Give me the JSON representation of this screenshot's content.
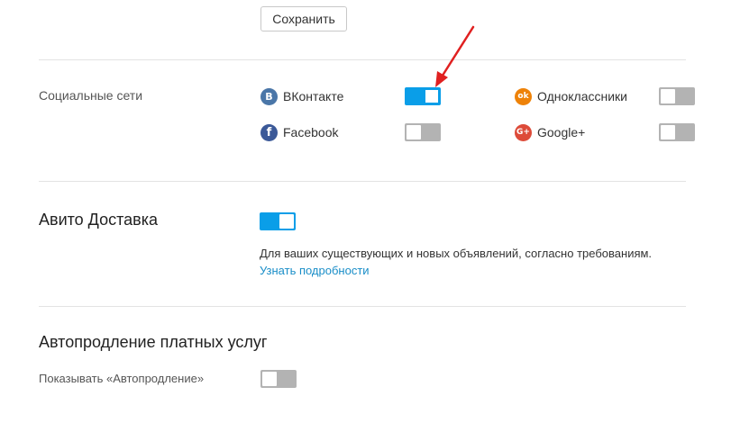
{
  "save": {
    "label": "Сохранить"
  },
  "social": {
    "section_label": "Социальные сети",
    "items": [
      {
        "name": "ВКонтакте",
        "icon": "vk-icon",
        "icon_glyph": "B",
        "color": "#4a76a8",
        "enabled": true
      },
      {
        "name": "Одноклассники",
        "icon": "ok-icon",
        "icon_glyph": "ok",
        "color": "#ee8208",
        "enabled": false
      },
      {
        "name": "Facebook",
        "icon": "facebook-icon",
        "icon_glyph": "f",
        "color": "#3b5998",
        "enabled": false
      },
      {
        "name": "Google+",
        "icon": "google-plus-icon",
        "icon_glyph": "G+",
        "color": "#dd4b39",
        "enabled": false
      }
    ]
  },
  "delivery": {
    "title": "Авито Доставка",
    "enabled": true,
    "description": "Для ваших существующих и новых объявлений, согласно требованиям.",
    "link": "Узнать подробности"
  },
  "autorenew": {
    "title": "Автопродление платных услуг",
    "show_label": "Показывать «Автопродление»",
    "enabled": false
  },
  "colors": {
    "accent": "#0a9ee8",
    "toggle_off": "#b3b3b3",
    "link": "#1a8ec8",
    "annotation_arrow": "#e02020"
  }
}
